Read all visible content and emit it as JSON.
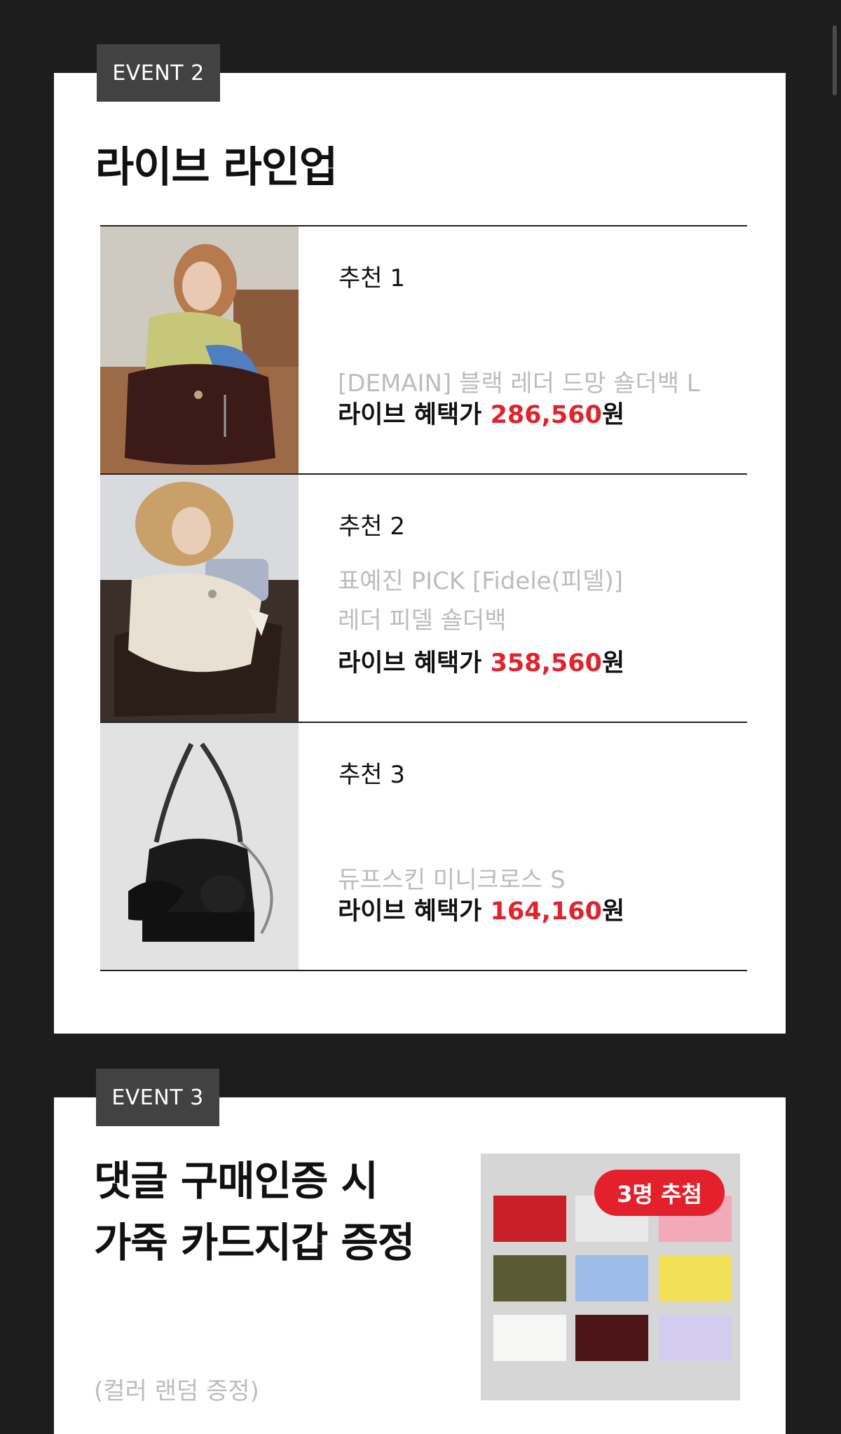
{
  "event2": {
    "tag": "EVENT 2",
    "title": "라이브 라인업",
    "items": [
      {
        "rec": "추천 1",
        "name_lines": [
          "[DEMAIN] 블랙 레더 드망 숄더백 L"
        ],
        "price_label": "라이브 혜택가 ",
        "price": "286,560",
        "currency": "원"
      },
      {
        "rec": "추천 2",
        "name_lines": [
          "표예진 PICK [Fidele(피델)]",
          "레더 피델 숄더백"
        ],
        "price_label": "라이브 혜택가 ",
        "price": "358,560",
        "currency": "원"
      },
      {
        "rec": "추천 3",
        "name_lines": [
          "듀프스킨 미니크로스 S"
        ],
        "price_label": "라이브 혜택가 ",
        "price": "164,160",
        "currency": "원"
      }
    ]
  },
  "event3": {
    "tag": "EVENT 3",
    "title_lines": [
      "댓글 구매인증 시",
      "가죽 카드지갑 증정"
    ],
    "note": "(컬러 랜덤 증정)",
    "badge": "3명 추첨"
  },
  "colors": {
    "accent_red": "#e0242e",
    "tag_bg": "#424242",
    "page_bg": "#1d1d1d"
  }
}
